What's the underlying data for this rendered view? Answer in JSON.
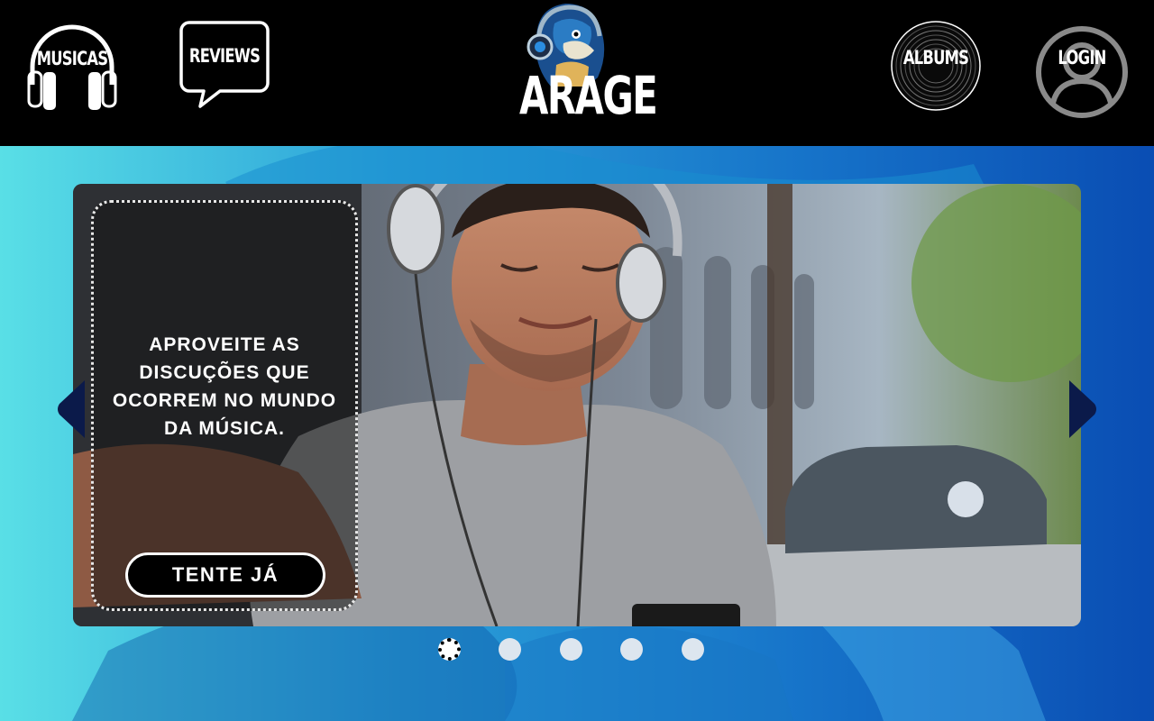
{
  "header": {
    "nav": {
      "musicas": "MUSICAS",
      "reviews": "REVIEWS",
      "albums": "ALBUMS",
      "login": "LOGIN"
    },
    "logo_text": "ARAGE"
  },
  "carousel": {
    "caption": "APROVEITE AS DISCUÇÕES QUE OCORREM NO MUNDO DA MÚSICA.",
    "cta_label": "TENTE JÁ",
    "slides_count": 5,
    "active_slide": 1
  },
  "colors": {
    "header_bg": "#000000",
    "hero_gradient_start": "#59dfe6",
    "hero_gradient_end": "#0a4db3",
    "arrow": "#0b1a4a",
    "cta_bg": "#000000"
  },
  "icons": [
    "headphones-icon",
    "speech-bubble-icon",
    "parrot-logo",
    "vinyl-record-icon",
    "user-avatar-icon",
    "chevron-left-icon",
    "chevron-right-icon"
  ]
}
